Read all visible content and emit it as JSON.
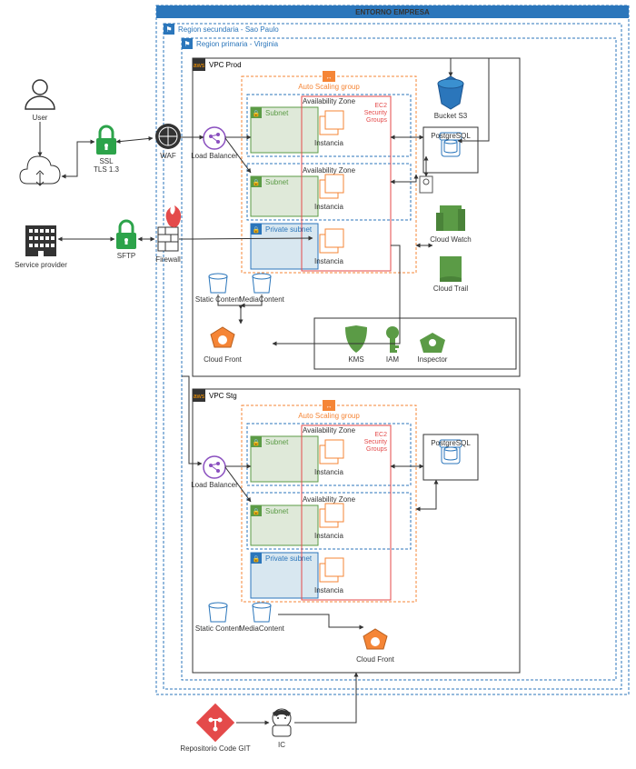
{
  "title": "ENTORNO EMPRESA",
  "regions": {
    "secondary": "Region secundaria - Sao Paulo",
    "primary": "Region primaria - Virginia"
  },
  "vpcProd": {
    "name": "VPC Prod",
    "asg": "Auto Scaling group",
    "az": "Availability Zone",
    "subnet": "Subnet",
    "privateSubnet": "Private subnet",
    "instancia": "Instancia",
    "secGroups": "EC2\nSecurity\nGroups"
  },
  "vpcStg": {
    "name": "VPC Stg",
    "asg": "Auto Scaling group",
    "az": "Availability Zone",
    "subnet": "Subnet",
    "privateSubnet": "Private subnet",
    "instancia": "Instancia",
    "secGroups": "EC2\nSecurity\nGroups"
  },
  "ext": {
    "user": "User",
    "serviceProvider": "Service provider",
    "ssl": "SSL\nTLS 1.3",
    "sftp": "SFTP",
    "waf": "WAF",
    "firewall": "Firewall"
  },
  "lb": "Load Balancer",
  "storage": {
    "static": "Static Content",
    "media": "MediaContent",
    "cloudfront": "Cloud Front"
  },
  "aws": {
    "s3": "Bucket S3",
    "postgres": "PostgreSQL",
    "cloudwatch": "Cloud Watch",
    "cloudtrail": "Cloud Trail",
    "kms": "KMS",
    "iam": "IAM",
    "inspector": "Inspector"
  },
  "cicd": {
    "git": "Repositorio Code GIT",
    "ic": "IC"
  }
}
